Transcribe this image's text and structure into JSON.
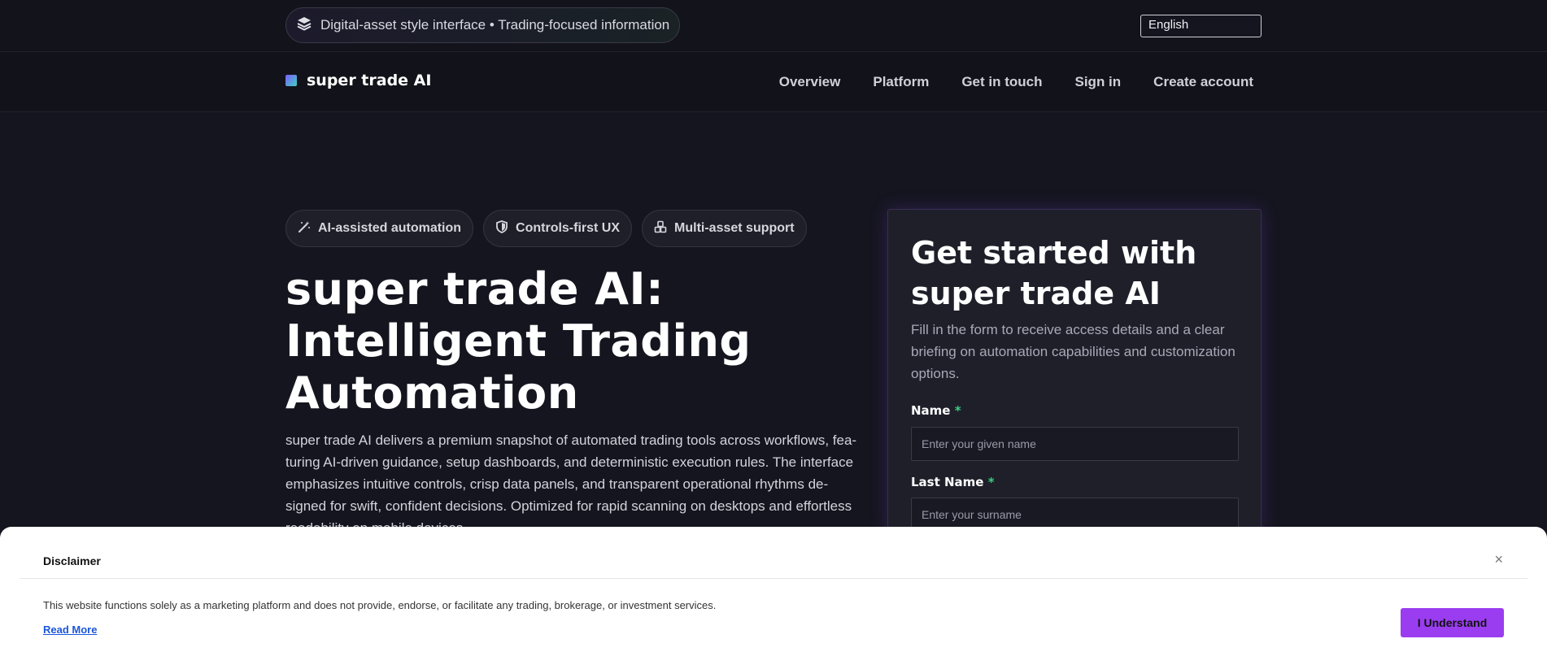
{
  "topbar": {
    "pill_text": "Digital-asset style interface • Trading-focused information",
    "pill_icon": "layers-icon",
    "language": "English"
  },
  "nav": {
    "brand": "super trade AI",
    "links": [
      "Overview",
      "Platform",
      "Get in touch",
      "Sign in",
      "Create account"
    ]
  },
  "hero": {
    "chips": [
      {
        "label": "AI-assisted automation",
        "icon": "magic-wand-icon"
      },
      {
        "label": "Controls-first UX",
        "icon": "shield-icon"
      },
      {
        "label": "Multi-asset support",
        "icon": "cubes-icon"
      }
    ],
    "title": "super trade AI: Intelligent Trading Automation",
    "description": "super trade AI delivers a premium snapshot of automated trading tools across workflows, fea­turing AI-driven guidance, setup dashboards, and deterministic execution rules. The interface emphasizes intuitive controls, crisp data panels, and transparent operational rhythms de­signed for swift, confident decisions. Optimized for rapid scanning on desktops and effortless readability on mobile devices."
  },
  "form": {
    "title": "Get started with super trade AI",
    "subtitle": "Fill in the form to receive access details and a clear briefing on automation capabilities and customization options.",
    "name_label": "Name",
    "name_placeholder": "Enter your given name",
    "last_name_label": "Last Name",
    "last_name_placeholder": "Enter your surname",
    "required_mark": "*"
  },
  "disclaimer": {
    "title": "Disclaimer",
    "close": "×",
    "text": "This website functions solely as a marketing platform and does not provide, endorse, or facilitate any trading, brokerage, or investment services.",
    "link": "Read More",
    "button": "I Understand"
  },
  "colors": {
    "accent": "#9a3df0",
    "required": "#35d07f",
    "link": "#1a56db"
  }
}
